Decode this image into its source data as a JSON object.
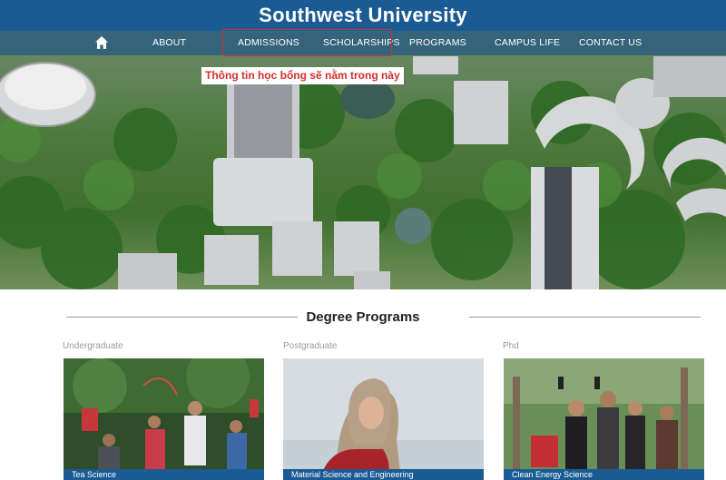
{
  "header": {
    "title": "Southwest University"
  },
  "nav": {
    "home_icon": "home-icon",
    "items": [
      {
        "label": "ABOUT"
      },
      {
        "label": "ADMISSIONS"
      },
      {
        "label": "SCHOLARSHIPS"
      },
      {
        "label": "PROGRAMS"
      },
      {
        "label": "CAMPUS LIFE"
      },
      {
        "label": "CONTACT US"
      }
    ]
  },
  "annotation": {
    "text": "Thông tin học bổng sẽ nằm trong này",
    "color": "#d0312d"
  },
  "degree_programs": {
    "title": "Degree Programs",
    "columns": [
      {
        "label": "Undergraduate",
        "card_caption": "Tea Science"
      },
      {
        "label": "Postgraduate",
        "card_caption": "Material Science and Engineering"
      },
      {
        "label": "Phd",
        "card_caption": "Clean Energy Science"
      }
    ]
  },
  "colors": {
    "brand": "#1a5b93",
    "accent": "#d0312d"
  }
}
